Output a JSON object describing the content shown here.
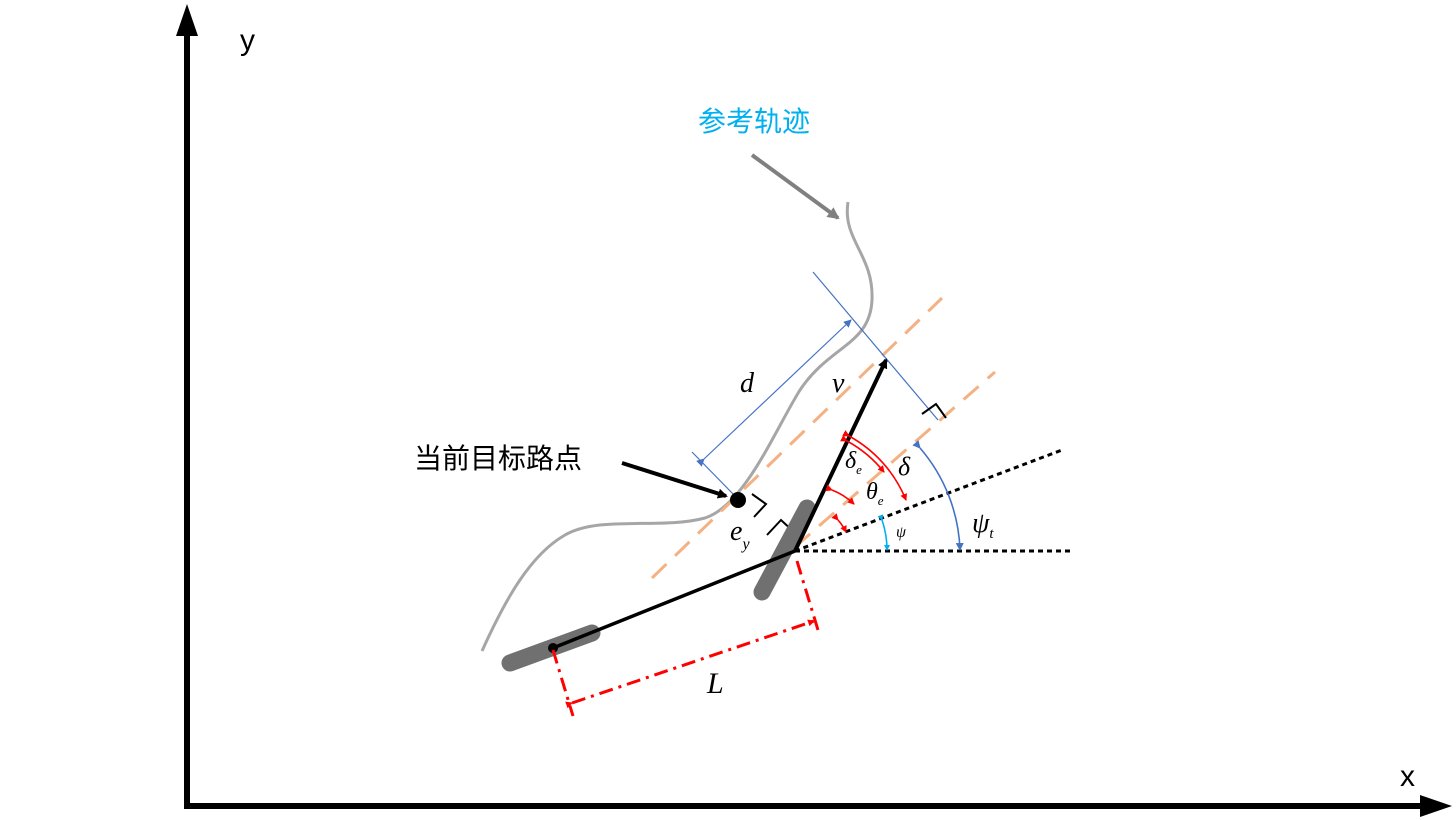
{
  "axes": {
    "x_label": "x",
    "y_label": "y"
  },
  "annotations": {
    "reference_path": "参考轨迹",
    "target_waypoint": "当前目标路点"
  },
  "symbols": {
    "lookahead_distance": "d",
    "velocity": "v",
    "wheelbase": "L",
    "lateral_error_main": "e",
    "lateral_error_sub": "y",
    "steer_error_main": "δ",
    "steer_error_sub": "e",
    "steer_angle": "δ",
    "heading_error_main": "θ",
    "heading_error_sub": "e",
    "heading": "ψ",
    "target_heading_main": "ψ",
    "target_heading_sub": "t"
  },
  "colors": {
    "axis": "#000000",
    "reference_path": "#a6a6a6",
    "reference_label": "#00b0f0",
    "pointer_arrow": "#808080",
    "vehicle": "#000000",
    "wheel": "#707070",
    "dashed_guides": "#f4b183",
    "dimension_blue": "#4472c4",
    "angle_red": "#ff0000",
    "angle_cyan": "#00b0f0",
    "wheelbase_red": "#ff0000"
  }
}
